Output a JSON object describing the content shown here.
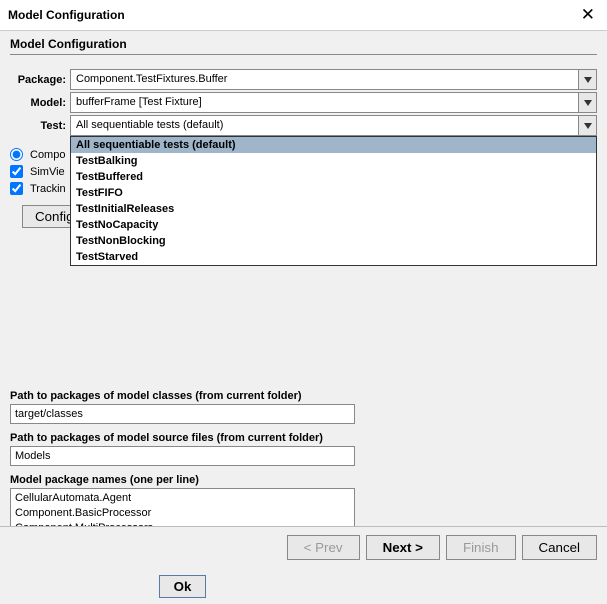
{
  "window": {
    "title": "Model Configuration"
  },
  "header": {
    "title": "Model Configuration"
  },
  "fields": {
    "package_label": "Package:",
    "package_value": "Component.TestFixtures.Buffer",
    "model_label": "Model:",
    "model_value": "bufferFrame [Test Fixture]",
    "test_label": "Test:",
    "test_value": "All sequentiable tests (default)"
  },
  "test_options": [
    "All sequentiable tests (default)",
    "TestBalking",
    "TestBuffered",
    "TestFIFO",
    "TestInitialReleases",
    "TestNoCapacity",
    "TestNonBlocking",
    "TestStarved"
  ],
  "view": {
    "compo_label": "Compo",
    "simview_label": "SimVie",
    "tracking_label": "Trackin",
    "config_btn": "Config"
  },
  "paths": {
    "classes_label": "Path to packages of model classes (from current folder)",
    "classes_value": "target/classes",
    "sources_label": "Path to packages of model source files (from current folder)",
    "sources_value": "Models",
    "packages_label": "Model package names (one per line)",
    "packages_value": "CellularAutomata.Agent\nComponent.BasicProcessor\nComponent.MultiProcessors\nComponent.TestFixtures.Buffer\nComponent.TestFixtures.Workstation"
  },
  "buttons": {
    "ok": "Ok",
    "prev": "< Prev",
    "next": "Next >",
    "finish": "Finish",
    "cancel": "Cancel"
  }
}
